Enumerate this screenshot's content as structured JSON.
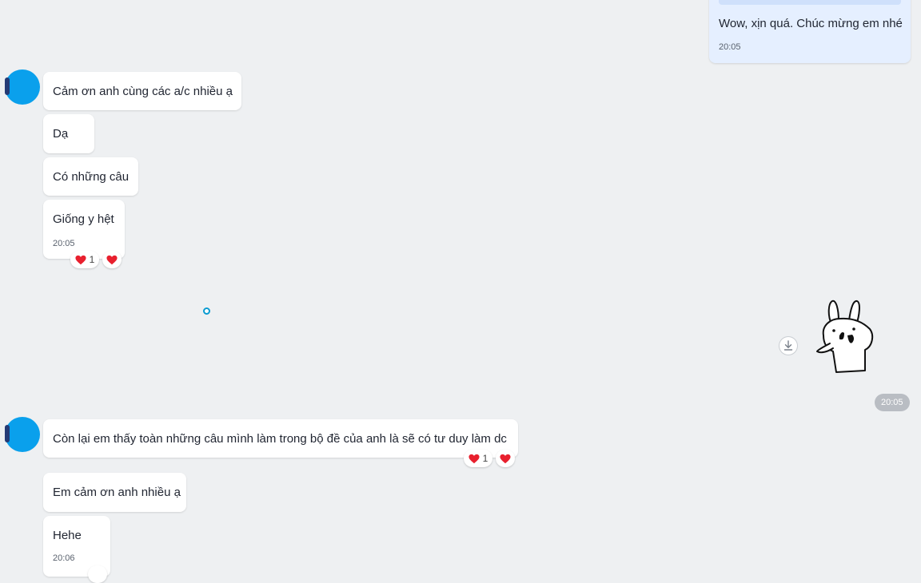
{
  "messages": {
    "m0": {
      "text": "Wow, xịn quá. Chúc mừng em nhé",
      "time": "20:05"
    },
    "m1": {
      "text": "Cảm ơn anh cùng các a/c nhiều ạ"
    },
    "m2": {
      "text": "Dạ"
    },
    "m3": {
      "text": "Có những câu"
    },
    "m4": {
      "text": "Giống y hệt",
      "time": "20:05",
      "reaction_count": "1"
    },
    "m5": {
      "text": "Còn lại em thấy toàn những câu mình làm trong bộ đề của anh là sẽ có tư duy làm dc",
      "reaction_count": "1"
    },
    "m6": {
      "text": "Em cảm ơn anh nhiều ạ"
    },
    "m7": {
      "text": "Hehe",
      "time": "20:06"
    }
  },
  "sticker": {
    "time": "20:05"
  },
  "colors": {
    "bg": "#eef0f2",
    "my_bubble": "#e5efff",
    "heart": "#e8202e",
    "avatar": "#0aa0ec"
  }
}
